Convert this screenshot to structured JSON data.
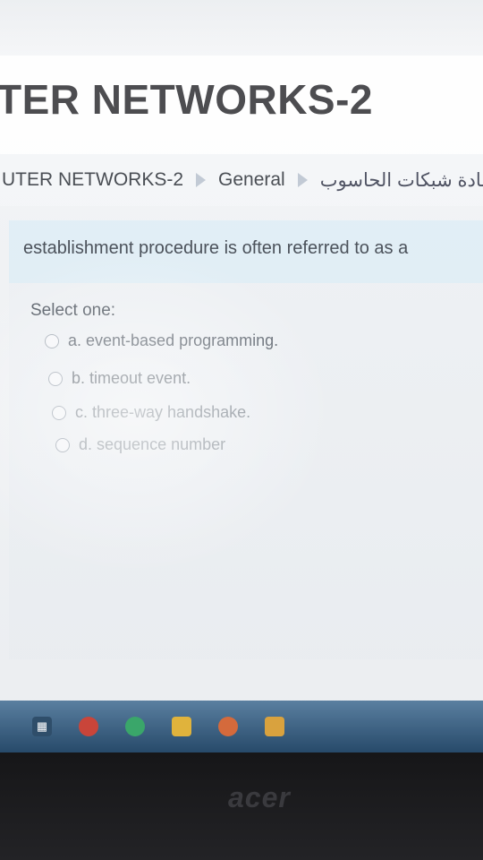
{
  "header": {
    "course_title": "TER NETWORKS-2"
  },
  "breadcrumb": {
    "items": [
      "UTER NETWORKS-2",
      "General",
      "إعادة شبكات الحاسوب"
    ]
  },
  "question": {
    "text": "establishment procedure is often referred to as a"
  },
  "answers": {
    "prompt": "Select one:",
    "options": [
      "a. event-based programming.",
      "b. timeout event.",
      "c. three-way handshake.",
      "d. sequence number"
    ]
  },
  "taskbar": {
    "icons": [
      "task-view-icon",
      "chrome-icon",
      "edge-icon",
      "file-explorer-icon",
      "app-icon",
      "store-icon"
    ]
  },
  "monitor": {
    "brand": "acer"
  }
}
